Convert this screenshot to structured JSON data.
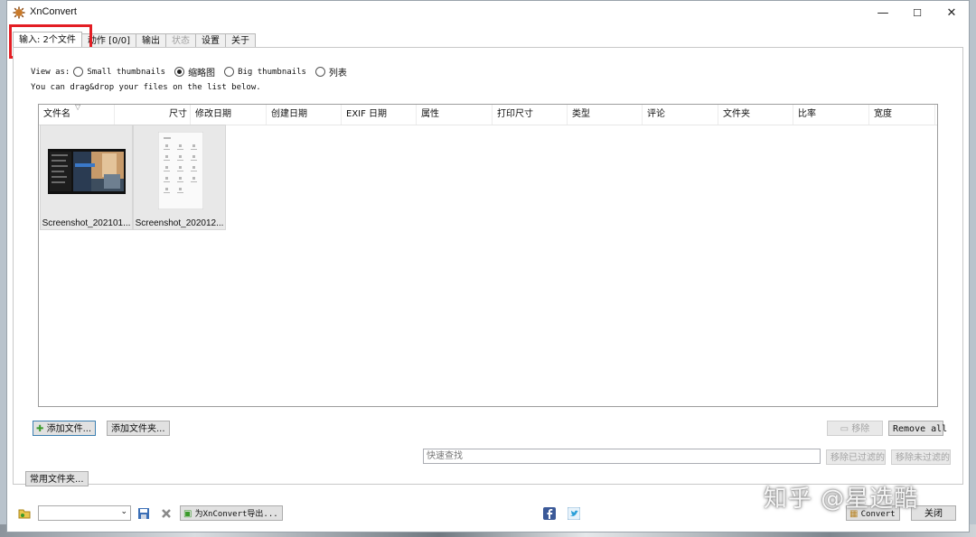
{
  "window": {
    "title": "XnConvert",
    "minimize": "—",
    "maximize": "☐",
    "close": "✕"
  },
  "tabs": [
    {
      "label": "输入: 2个文件",
      "state": "active"
    },
    {
      "label": "动作 [0/0]",
      "state": "normal"
    },
    {
      "label": "输出",
      "state": "normal"
    },
    {
      "label": "状态",
      "state": "disabled"
    },
    {
      "label": "设置",
      "state": "normal"
    },
    {
      "label": "关于",
      "state": "normal"
    }
  ],
  "view_as": {
    "label": "View as:",
    "options": [
      {
        "label": "Small thumbnails",
        "selected": false
      },
      {
        "label": "缩略图",
        "selected": true
      },
      {
        "label": "Big thumbnails",
        "selected": false
      },
      {
        "label": "列表",
        "selected": false
      }
    ]
  },
  "hint": "You can drag&drop your files on the list below.",
  "columns": [
    "文件名",
    "尺寸",
    "修改日期",
    "创建日期",
    "EXIF 日期",
    "属性",
    "打印尺寸",
    "类型",
    "评论",
    "文件夹",
    "比率",
    "宽度"
  ],
  "files": [
    {
      "name": "Screenshot_202101..."
    },
    {
      "name": "Screenshot_202012..."
    }
  ],
  "buttons": {
    "add_files": "添加文件...",
    "add_folder": "添加文件夹...",
    "remove": "移除",
    "remove_all": "Remove all",
    "remove_filtered": "移除已过滤的",
    "remove_unfiltered": "移除未过滤的",
    "common_folders": "常用文件夹...",
    "export": "为XnConvert导出...",
    "convert": "Convert",
    "close": "关闭"
  },
  "search": {
    "placeholder": "快速查找"
  },
  "watermark": "知乎 @星选酷",
  "colors": {
    "highlight": "#e31e24",
    "primary_border": "#3c7fb1"
  }
}
